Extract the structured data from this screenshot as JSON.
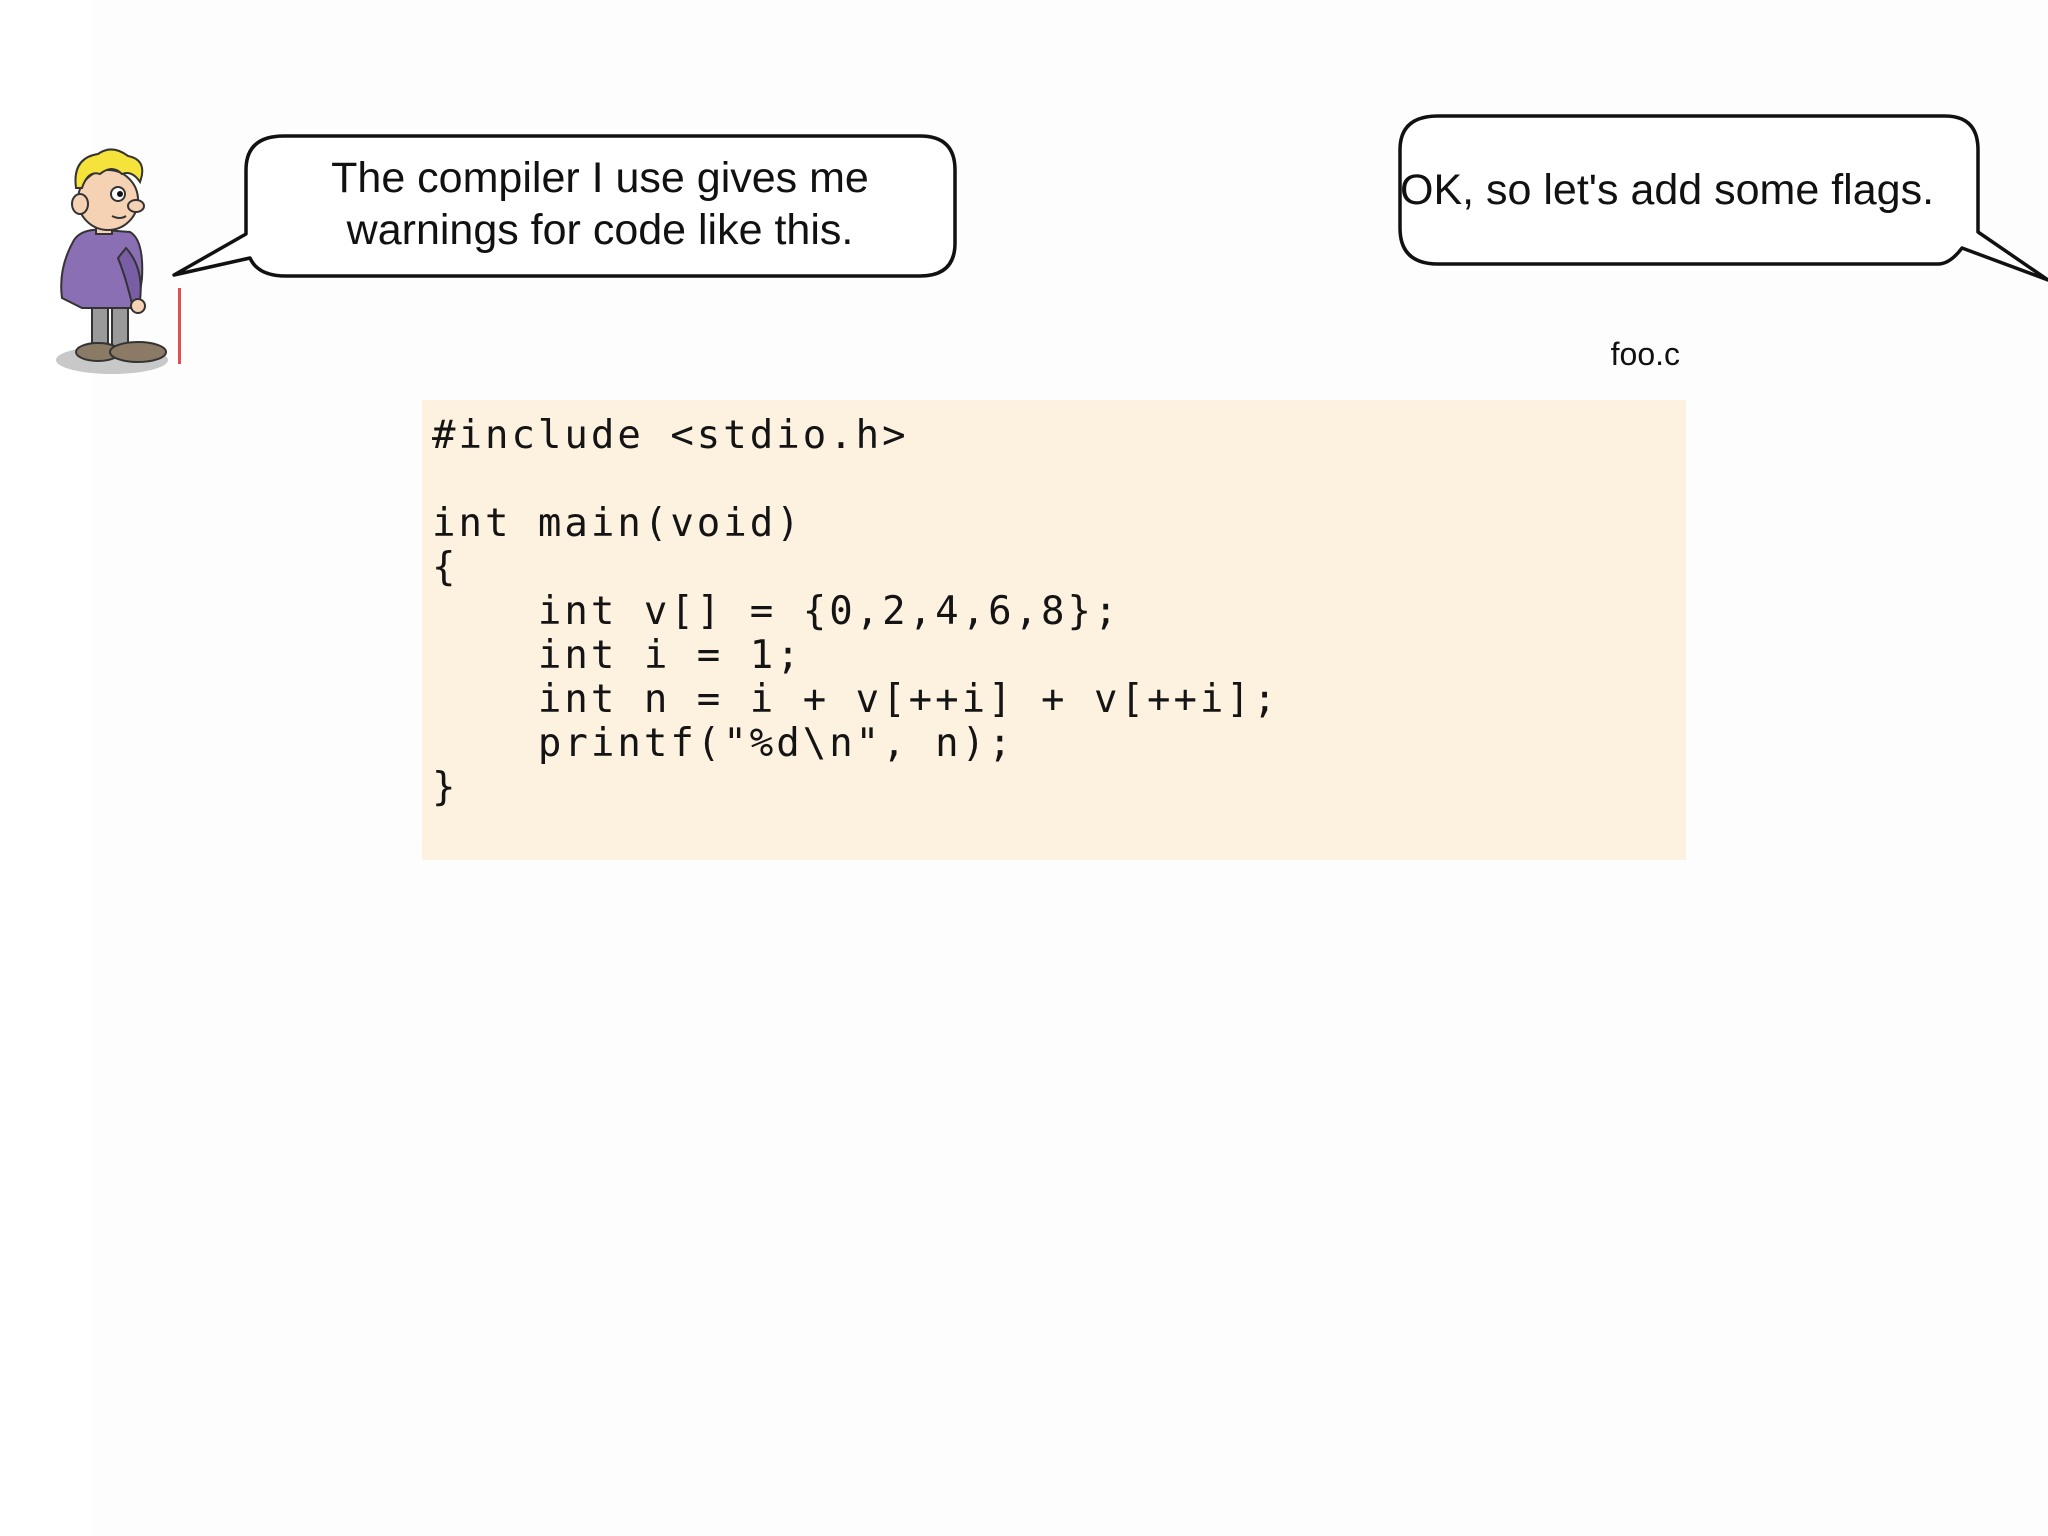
{
  "speech": {
    "left_lines": [
      "The compiler I use gives me",
      "warnings for code like this."
    ],
    "right": "OK, so let's add some flags."
  },
  "file": {
    "name": "foo.c"
  },
  "code": {
    "lines": [
      "#include <stdio.h>",
      "",
      "int main(void)",
      "{",
      "    int v[] = {0,2,4,6,8};",
      "    int i = 1;",
      "    int n = i + v[++i] + v[++i];",
      "    printf(\"%d\\n\", n);",
      "}"
    ]
  },
  "colors": {
    "code_background": "#fdf2e0",
    "character_hair": "#f5e23a",
    "character_shirt": "#8b6fb5"
  },
  "icons": {
    "character": "cartoon-boy-icon"
  }
}
